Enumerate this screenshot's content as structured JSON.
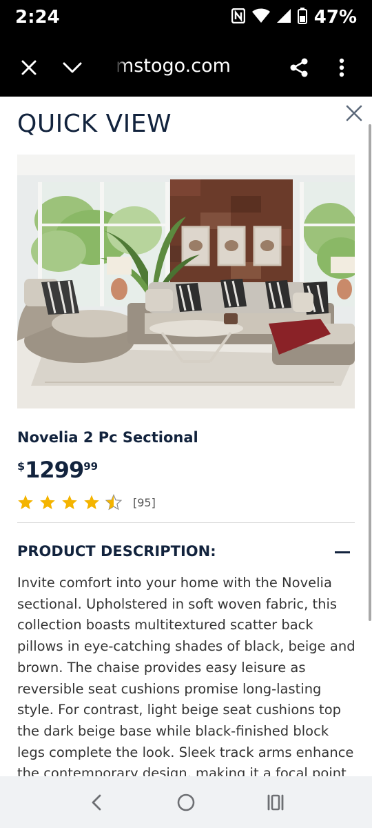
{
  "status_bar": {
    "time": "2:24",
    "battery": "47%",
    "icons": [
      "nfc-icon",
      "wifi-icon",
      "signal-icon",
      "battery-icon"
    ]
  },
  "browser": {
    "url": "mstogo.com",
    "icons": [
      "close-icon",
      "chevron-down-icon",
      "share-icon",
      "more-vert-icon"
    ]
  },
  "quick_view": {
    "title": "QUICK VIEW",
    "close_icon": "close-icon"
  },
  "product": {
    "name": "Novelia 2 Pc Sectional",
    "price_currency": "$",
    "price_dollars": "1299",
    "price_cents": "99",
    "rating": 4.5,
    "rating_max": 5,
    "review_count": "[95]",
    "star_color": "#f4b400"
  },
  "description": {
    "header": "PRODUCT DESCRIPTION:",
    "text": "Invite comfort into your home with the Novelia sectional. Upholstered in soft woven fabric, this collection boasts multitextured scatter back pillows in eye-catching shades of black, beige and brown. The chaise provides easy leisure as reversible seat cushions promise long-lasting style. For contrast, light beige seat cushions top the dark beige base while black-finished block legs complete the look. Sleek track arms enhance the contemporary design, making it a focal point"
  },
  "nav_bar": {
    "icons": [
      "back-icon",
      "home-icon",
      "recents-icon"
    ]
  },
  "colors": {
    "brand_navy": "#12233d",
    "status_bg": "#000000",
    "nav_bg": "#f0f2f4"
  }
}
